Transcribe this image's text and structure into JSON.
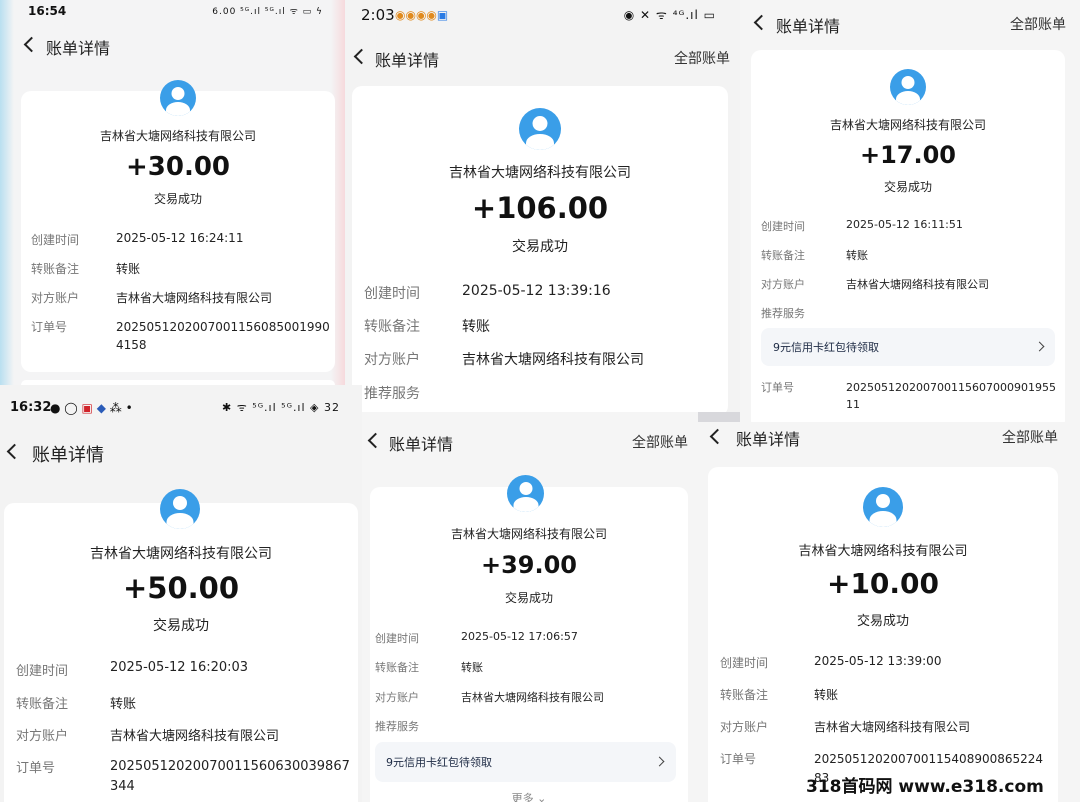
{
  "screens": [
    {
      "status_time": "16:54",
      "nav_title": "账单详情",
      "all_bills": "",
      "company": "吉林省大塘网络科技有限公司",
      "amount": "+30.00",
      "status": "交易成功",
      "rows": [
        {
          "label": "创建时间",
          "value": "2025-05-12 16:24:11"
        },
        {
          "label": "转账备注",
          "value": "转账"
        },
        {
          "label": "对方账户",
          "value": "吉林省大塘网络科技有限公司"
        },
        {
          "label": "订单号",
          "value": "20250512020070011560850019904158"
        }
      ]
    },
    {
      "status_time": "2:03",
      "nav_title": "账单详情",
      "all_bills": "全部账单",
      "company": "吉林省大塘网络科技有限公司",
      "amount": "+106.00",
      "status": "交易成功",
      "rows": [
        {
          "label": "创建时间",
          "value": "2025-05-12 13:39:16"
        },
        {
          "label": "转账备注",
          "value": "转账"
        },
        {
          "label": "对方账户",
          "value": "吉林省大塘网络科技有限公司"
        },
        {
          "label": "推荐服务",
          "value": ""
        }
      ]
    },
    {
      "status_time": "",
      "nav_title": "账单详情",
      "all_bills": "全部账单",
      "company": "吉林省大塘网络科技有限公司",
      "amount": "+17.00",
      "status": "交易成功",
      "rows": [
        {
          "label": "创建时间",
          "value": "2025-05-12 16:11:51"
        },
        {
          "label": "转账备注",
          "value": "转账"
        },
        {
          "label": "对方账户",
          "value": "吉林省大塘网络科技有限公司"
        },
        {
          "label": "推荐服务",
          "value": ""
        },
        {
          "label": "订单号",
          "value": "20250512020070011560700090195511"
        }
      ],
      "promo": "9元信用卡红包待领取"
    },
    {
      "status_time": "16:32",
      "nav_title": "账单详情",
      "all_bills": "",
      "company": "吉林省大塘网络科技有限公司",
      "amount": "+50.00",
      "status": "交易成功",
      "rows": [
        {
          "label": "创建时间",
          "value": "2025-05-12 16:20:03"
        },
        {
          "label": "转账备注",
          "value": "转账"
        },
        {
          "label": "对方账户",
          "value": "吉林省大塘网络科技有限公司"
        },
        {
          "label": "订单号",
          "value": "20250512020070011560630039867344"
        }
      ]
    },
    {
      "status_time": "",
      "nav_title": "账单详情",
      "all_bills": "全部账单",
      "company": "吉林省大塘网络科技有限公司",
      "amount": "+39.00",
      "status": "交易成功",
      "rows": [
        {
          "label": "创建时间",
          "value": "2025-05-12 17:06:57"
        },
        {
          "label": "转账备注",
          "value": "转账"
        },
        {
          "label": "对方账户",
          "value": "吉林省大塘网络科技有限公司"
        },
        {
          "label": "推荐服务",
          "value": ""
        }
      ],
      "promo": "9元信用卡红包待领取",
      "more": "更多"
    },
    {
      "status_time": "",
      "nav_title": "账单详情",
      "all_bills": "全部账单",
      "company": "吉林省大塘网络科技有限公司",
      "amount": "+10.00",
      "status": "交易成功",
      "rows": [
        {
          "label": "创建时间",
          "value": "2025-05-12 13:39:00"
        },
        {
          "label": "转账备注",
          "value": "转账"
        },
        {
          "label": "对方账户",
          "value": "吉林省大塘网络科技有限公司"
        },
        {
          "label": "订单号",
          "value": "20250512020070011540890086522483"
        }
      ]
    }
  ],
  "order_wrap": [
    "8",
    "1",
    "4",
    "83"
  ],
  "status_icons": {
    "s1": "6.00 ⁵ᴳ.ıl ⁵ᴳ.ıl ᯤ ▭ ϟ",
    "s2": "◉ ✕ ᯤ ⁴ᴳ.ıl ▭",
    "s4": "✱ ᯤ ⁵ᴳ.ıl ⁵ᴳ.ıl ◈ 32"
  },
  "watermark": "318首码网 www.e318.com",
  "colors": {
    "avatar": "#3a9ee8",
    "card": "#ffffff"
  }
}
